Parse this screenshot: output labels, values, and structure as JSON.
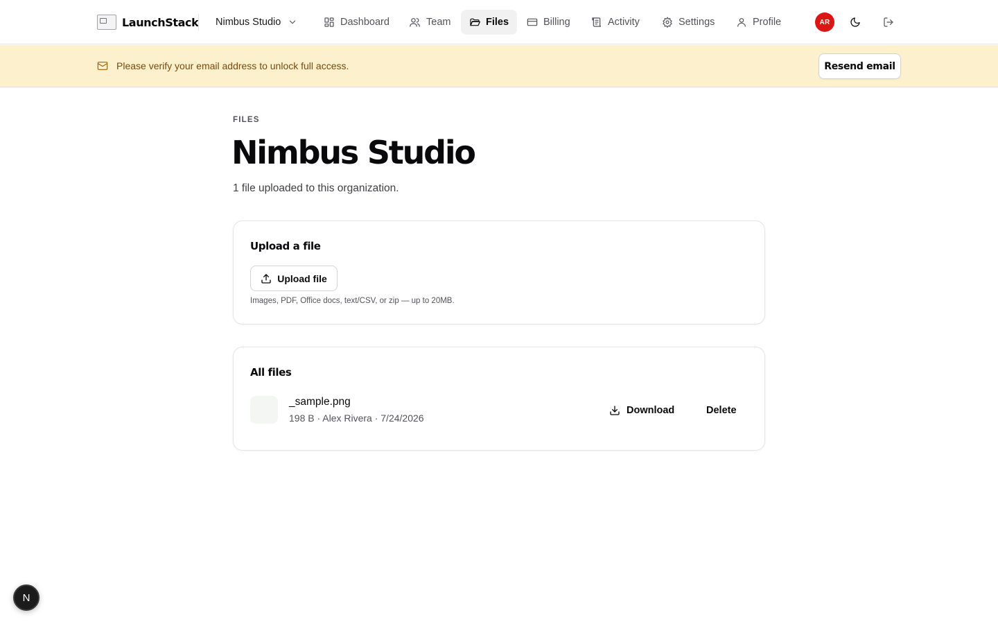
{
  "header": {
    "brand": "LaunchStack",
    "org_name": "Nimbus Studio",
    "nav": [
      {
        "label": "Dashboard",
        "icon": "dashboard-icon"
      },
      {
        "label": "Team",
        "icon": "users-icon"
      },
      {
        "label": "Files",
        "icon": "folder-icon",
        "active": true
      },
      {
        "label": "Billing",
        "icon": "credit-card-icon"
      },
      {
        "label": "Activity",
        "icon": "activity-log-icon"
      },
      {
        "label": "Settings",
        "icon": "gear-icon"
      },
      {
        "label": "Profile",
        "icon": "user-icon"
      }
    ],
    "avatar_initials": "AR",
    "avatar_color": "#dc1515"
  },
  "banner": {
    "message": "Please verify your email address to unlock full access.",
    "button_label": "Resend email",
    "background": "#fdf0cd",
    "text_color": "#7a4a0b"
  },
  "page": {
    "eyebrow": "FILES",
    "title": "Nimbus Studio",
    "subtitle": "1 file uploaded to this organization."
  },
  "upload_card": {
    "title": "Upload a file",
    "button_label": "Upload file",
    "hint": "Images, PDF, Office docs, text/CSV, or zip — up to 20MB."
  },
  "files_card": {
    "title": "All files",
    "files": [
      {
        "name": "_sample.png",
        "meta": "198 B · Alex Rivera · 7/24/2026",
        "download_label": "Download",
        "delete_label": "Delete"
      }
    ]
  },
  "dev_badge": {
    "label": "N"
  }
}
